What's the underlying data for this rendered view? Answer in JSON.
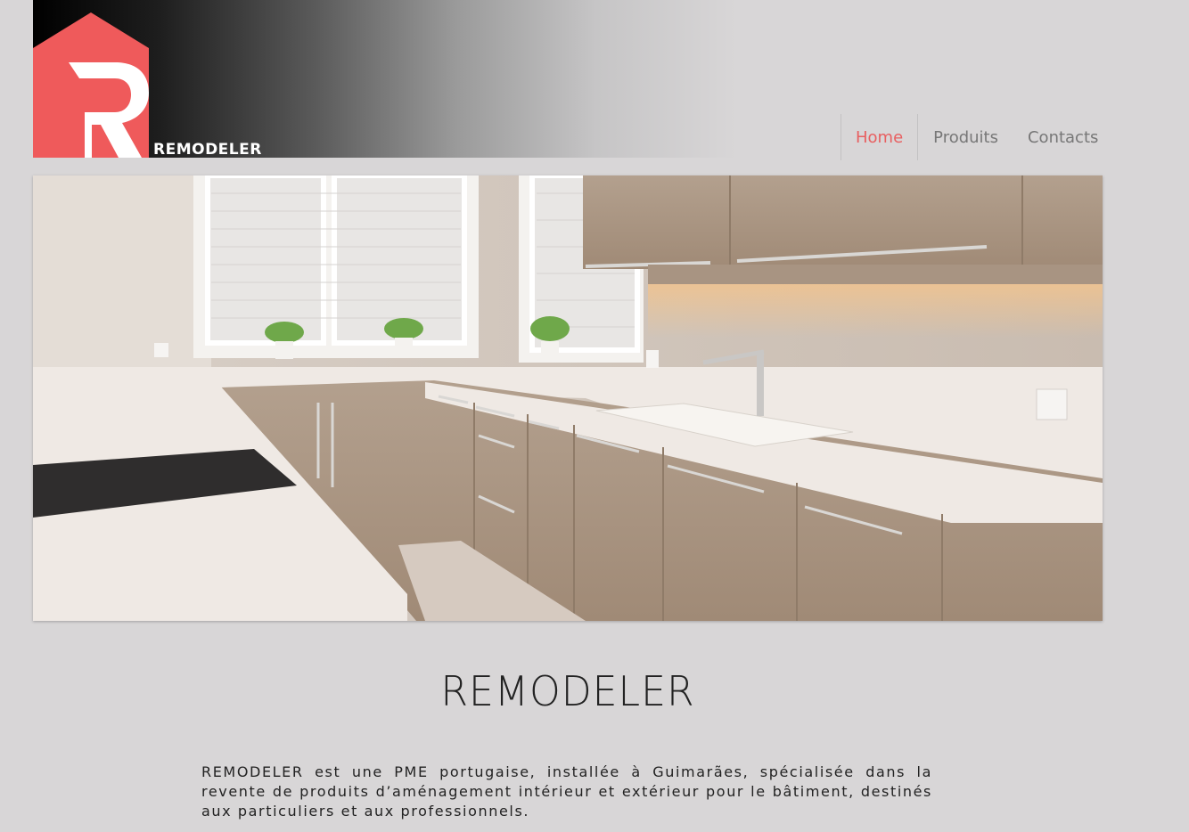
{
  "brand": {
    "name": "REMODELER",
    "logo_letter": "R"
  },
  "colors": {
    "accent": "#e85f60",
    "background": "#d8d6d7",
    "nav_text": "#777777",
    "text": "#222222"
  },
  "nav": {
    "items": [
      {
        "label": "Home",
        "active": true
      },
      {
        "label": "Produits",
        "active": false
      },
      {
        "label": "Contacts",
        "active": false
      }
    ]
  },
  "hero": {
    "icon": "kitchen-photo"
  },
  "main": {
    "title": "REMODELER",
    "intro": "REMODELER est une PME portugaise, installée à Guimarães, spécialisée dans la revente de produits d’aménagement intérieur et extérieur pour le bâtiment, destinés aux particuliers et aux professionnels."
  }
}
